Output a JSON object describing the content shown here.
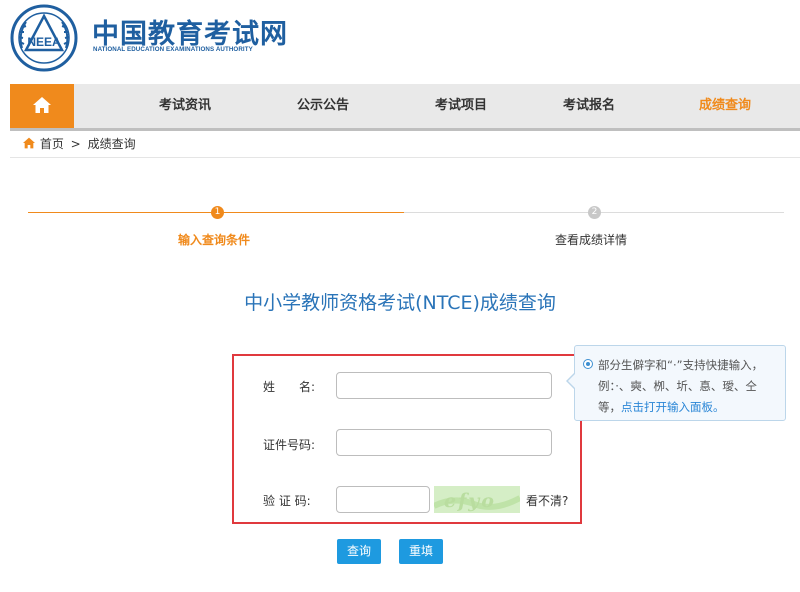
{
  "header": {
    "logo_text": "NEEA",
    "title": "中国教育考试网",
    "subtitle": "NATIONAL EDUCATION EXAMINATIONS AUTHORITY"
  },
  "nav": {
    "home_icon": "home-icon",
    "items": [
      {
        "label": "考试资讯"
      },
      {
        "label": "公示公告"
      },
      {
        "label": "考试项目"
      },
      {
        "label": "考试报名"
      },
      {
        "label": "成绩查询"
      }
    ],
    "active_color": "#f08a1c"
  },
  "breadcrumb": {
    "home": "首页",
    "separator": ">",
    "current": "成绩查询"
  },
  "steps": [
    {
      "number": "1",
      "label": "输入查询条件",
      "state": "active"
    },
    {
      "number": "2",
      "label": "查看成绩详情",
      "state": "pending"
    }
  ],
  "form": {
    "title": "中小学教师资格考试(NTCE)成绩查询",
    "name_label": "姓　　名:",
    "id_label": "证件号码:",
    "captcha_label": "验 证 码:",
    "name_value": "",
    "id_value": "",
    "captcha_value": "",
    "captcha_image_text": "efyo",
    "refresh_label": "看不清?",
    "query_button": "查询",
    "reset_button": "重填"
  },
  "tooltip": {
    "text": "部分生僻字和“·”支持快捷输入，例：·、奭、栁、圻、惪、璦、仝等，",
    "link": "点击打开输入面板。"
  },
  "colors": {
    "brand_blue": "#1f5fa0",
    "orange": "#f08a1c",
    "button_blue": "#1e9ae0",
    "highlight_red": "#e0393e"
  }
}
